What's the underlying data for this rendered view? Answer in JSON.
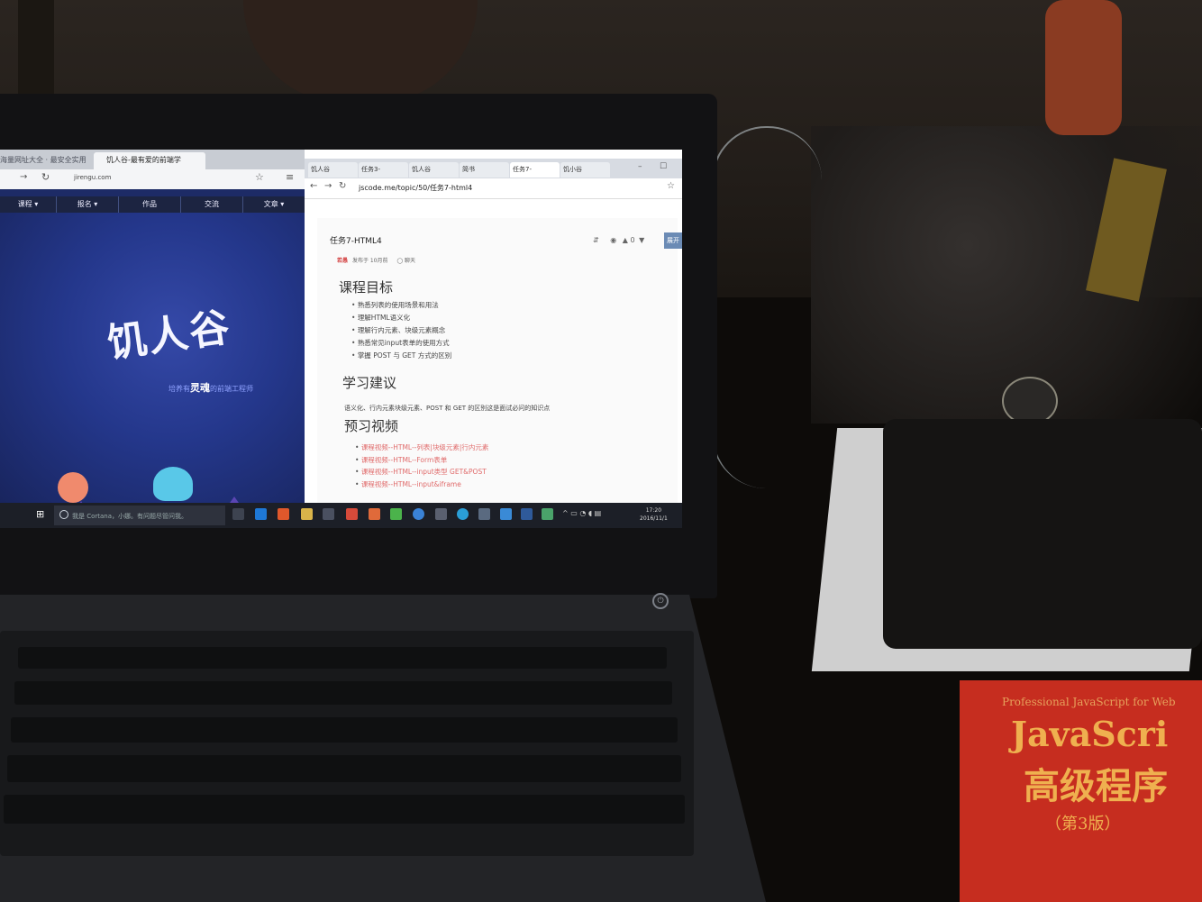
{
  "left_browser": {
    "tabs": [
      "海量网址大全 · 最安全实用",
      "饥人谷-最有爱的前端学"
    ],
    "url": "jirengu.com",
    "nav": [
      "课程 ▾",
      "报名 ▾",
      "作品",
      "交流",
      "文章 ▾"
    ],
    "logo": "饥人谷",
    "slogan_pre": "培养有",
    "slogan_bold": "灵魂",
    "slogan_post": "的前端工程师"
  },
  "right_browser": {
    "tabs": [
      "饥人谷",
      "任务3-",
      "饥人谷",
      "简书",
      "任务7-",
      "饥小谷"
    ],
    "url": "jscode.me/topic/50/任务7-html4",
    "title": "任务7-HTML4",
    "author": "若愚",
    "meta": "发布于 10月前",
    "chat": "聊天",
    "expand": "展开",
    "counts": "0",
    "sections": {
      "goals_title": "课程目标",
      "goals": [
        "熟悉列表的使用场景和用法",
        "理解HTML语义化",
        "理解行内元素、块级元素概念",
        "熟悉常见input表单的使用方式",
        "掌握 POST 与 GET 方式的区别"
      ],
      "advice_title": "学习建议",
      "advice": "语义化、行内元素块级元素、POST 和 GET 的区别这是面试必问的知识点",
      "videos_title": "预习视频",
      "videos": [
        "课程视频--HTML--列表|块级元素|行内元素",
        "课程视频--HTML--Form表单",
        "课程视频--HTML--input类型 GET&POST",
        "课程视频--HTML--input&iframe"
      ]
    }
  },
  "taskbar": {
    "search": "我是 Cortana，小娜。有问题尽管问我。",
    "time": "17:20",
    "date": "2016/11/1"
  },
  "book": {
    "subtitle": "Professional JavaScript for Web",
    "title": "JavaScri",
    "title_cn": "高级程序",
    "edition": "（第3版）"
  }
}
